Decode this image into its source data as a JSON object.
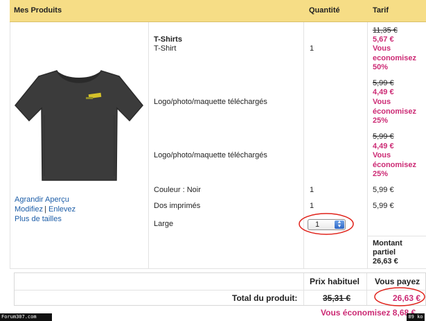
{
  "header": {
    "products": "Mes Produits",
    "quantity": "Quantité",
    "price": "Tarif"
  },
  "links": {
    "enlarge": "Agrandir Aperçu",
    "modify": "Modifiez",
    "separator": "|",
    "remove": "Enlevez",
    "more_sizes": "Plus de tailles"
  },
  "items": {
    "title": "T-Shirts",
    "subtitle": "T-Shirt",
    "subtitle_qty": "1",
    "logo1": "Logo/photo/maquette téléchargés",
    "logo2": "Logo/photo/maquette téléchargés",
    "color": "Couleur : Noir",
    "color_qty": "1",
    "print": "Dos imprimés",
    "print_qty": "1",
    "size": "Large",
    "size_select": "1"
  },
  "prices": {
    "p1_old": "11,35 €",
    "p1_new": "5,67 €",
    "p1_save_1": "Vous",
    "p1_save_2": "economisez",
    "p1_save_3": "50%",
    "p2_old": "5,99 €",
    "p2_new": "4,49 €",
    "p2_save_1": "Vous",
    "p2_save_2": "économisez",
    "p2_save_3": "25%",
    "p3_old": "5,99 €",
    "p3_new": "4,49 €",
    "p3_save_1": "Vous",
    "p3_save_2": "économisez",
    "p3_save_3": "25%",
    "color_price": "5,99 €",
    "print_price": "5,99 €",
    "partial_1": "Montant",
    "partial_2": "partiel",
    "partial_value": "26,63 €"
  },
  "footer": {
    "regular_label": "Prix habituel",
    "you_pay_label": "Vous payez",
    "total_label": "Total du produit:",
    "regular_value": "35,31 €",
    "you_pay_value": "26,63 €",
    "savings": "Vous économisez 8,68 €"
  },
  "statusbar": {
    "left": "Forum307.com",
    "right": "89 ko"
  },
  "colors": {
    "header_bg": "#f6dd86",
    "accent_pink": "#cc2a74",
    "link_blue": "#1d5ea8",
    "annotation_red": "#e0221a"
  },
  "icons": {
    "product": "tshirt-image",
    "select_arrow": "up-down-arrow-icon"
  }
}
